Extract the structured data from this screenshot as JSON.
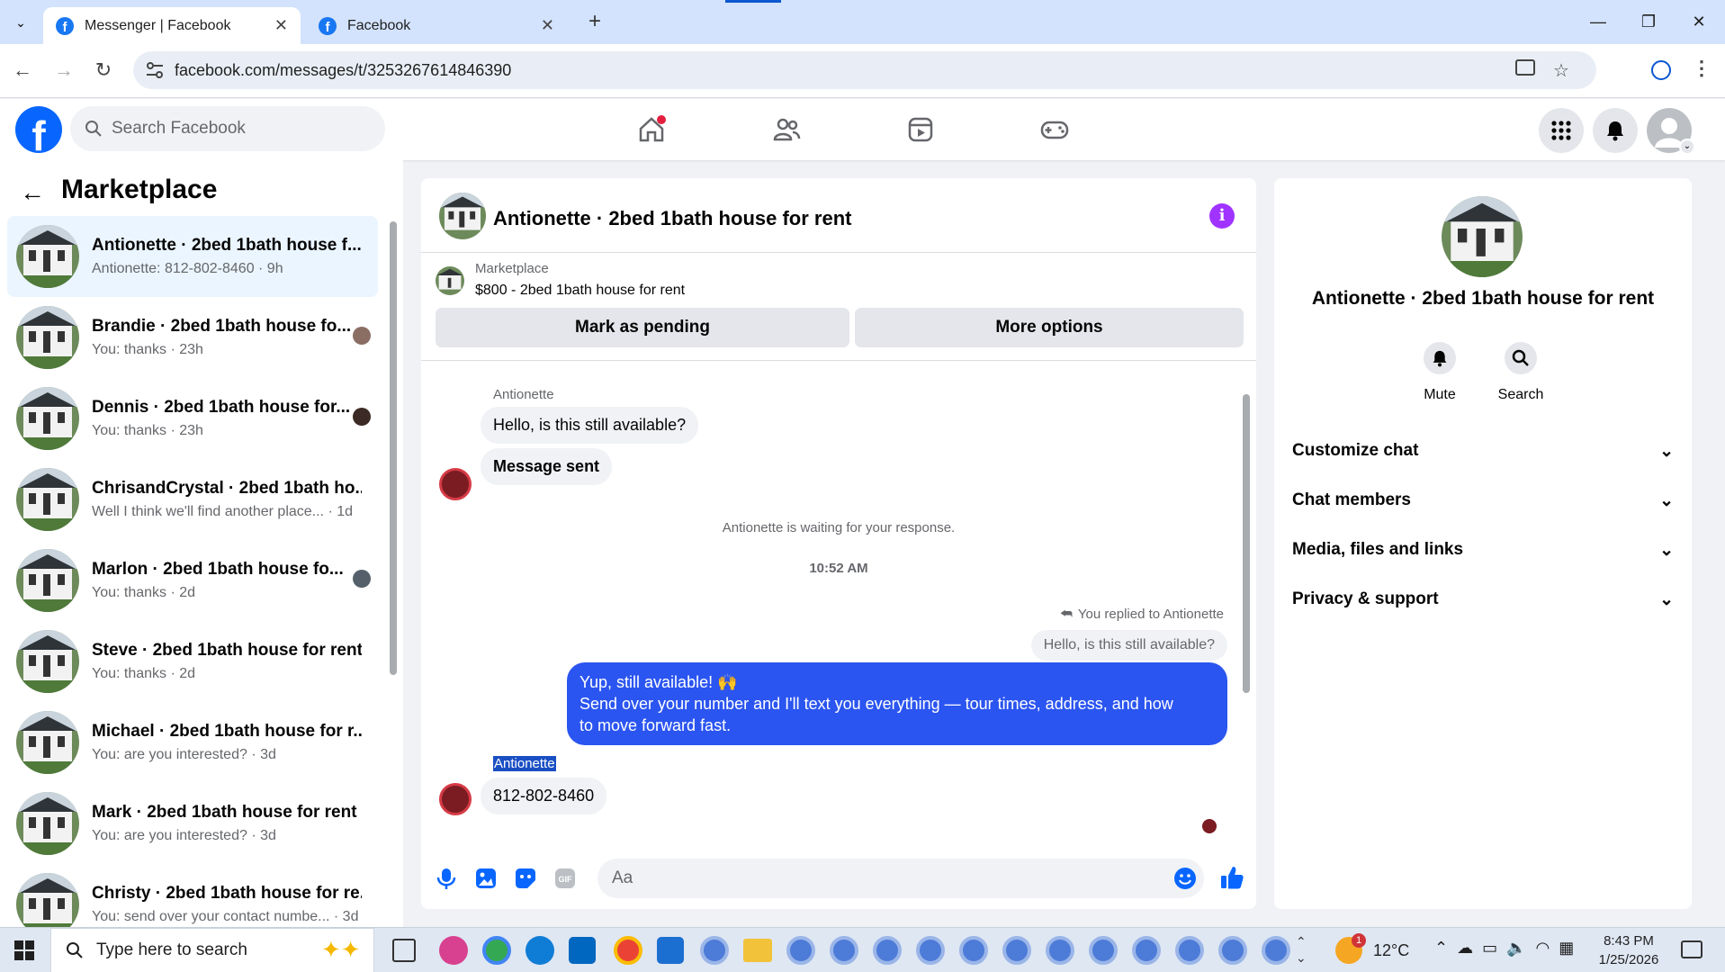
{
  "browser": {
    "tabs": [
      {
        "label": "Messenger | Facebook",
        "active": true
      },
      {
        "label": "Facebook",
        "active": false
      }
    ],
    "url": "facebook.com/messages/t/3253267614846390"
  },
  "fb_header": {
    "logo": "f",
    "search_placeholder": "Search Facebook"
  },
  "left_panel": {
    "title": "Marketplace",
    "conversations": [
      {
        "name": "Antionette · 2bed 1bath house f...",
        "snippet": "Antionette: 812-802-8460 · 9h"
      },
      {
        "name": "Brandie · 2bed 1bath house fo...",
        "snippet": "You: thanks · 23h"
      },
      {
        "name": "Dennis · 2bed 1bath house for...",
        "snippet": "You: thanks · 23h"
      },
      {
        "name": "ChrisandCrystal · 2bed 1bath ho...",
        "snippet": "Well I think we'll find another place... · 1d"
      },
      {
        "name": "Marlon · 2bed 1bath house fo...",
        "snippet": "You: thanks · 2d"
      },
      {
        "name": "Steve · 2bed 1bath house for rent",
        "snippet": "You: thanks · 2d"
      },
      {
        "name": "Michael · 2bed 1bath house for r...",
        "snippet": "You: are you interested? · 3d"
      },
      {
        "name": "Mark · 2bed 1bath house for rent",
        "snippet": "You: are you interested? · 3d"
      },
      {
        "name": "Christy · 2bed 1bath house for re...",
        "snippet": "You: send over your contact numbe... · 3d"
      }
    ]
  },
  "chat": {
    "title": "Antionette · 2bed 1bath house for rent",
    "listing_source": "Marketplace",
    "listing_desc": "$800 - 2bed 1bath house for rent",
    "btn_pending": "Mark as pending",
    "btn_more": "More options",
    "sender_1": "Antionette",
    "msg_1": "Hello, is this still available?",
    "msg_2": "Message sent",
    "waiting": "Antionette is waiting for your response.",
    "time": "10:52 AM",
    "replied_to": "You replied to Antionette",
    "quoted": "Hello, is this still available?",
    "my_msg_line1": "Yup, still available! 🙌",
    "my_msg_line2": "Send over your number and I'll text you everything — tour times, address, and how",
    "my_msg_line3": "to move forward fast.",
    "sender_2": "Antionette",
    "msg_3": "812-802-8460",
    "composer_placeholder": "Aa"
  },
  "right_panel": {
    "name": "Antionette · 2bed 1bath house for rent",
    "mute": "Mute",
    "search": "Search",
    "sections": [
      "Customize chat",
      "Chat members",
      "Media, files and links",
      "Privacy & support"
    ]
  },
  "taskbar": {
    "search_placeholder": "Type here to search",
    "weather": "12°C",
    "time": "8:43 PM",
    "date": "1/25/2026",
    "weather_badge": "1"
  },
  "colors": {
    "fb_blue": "#0866ff",
    "bubble_blue": "#2b55f0",
    "info_purple": "#a033ff"
  }
}
